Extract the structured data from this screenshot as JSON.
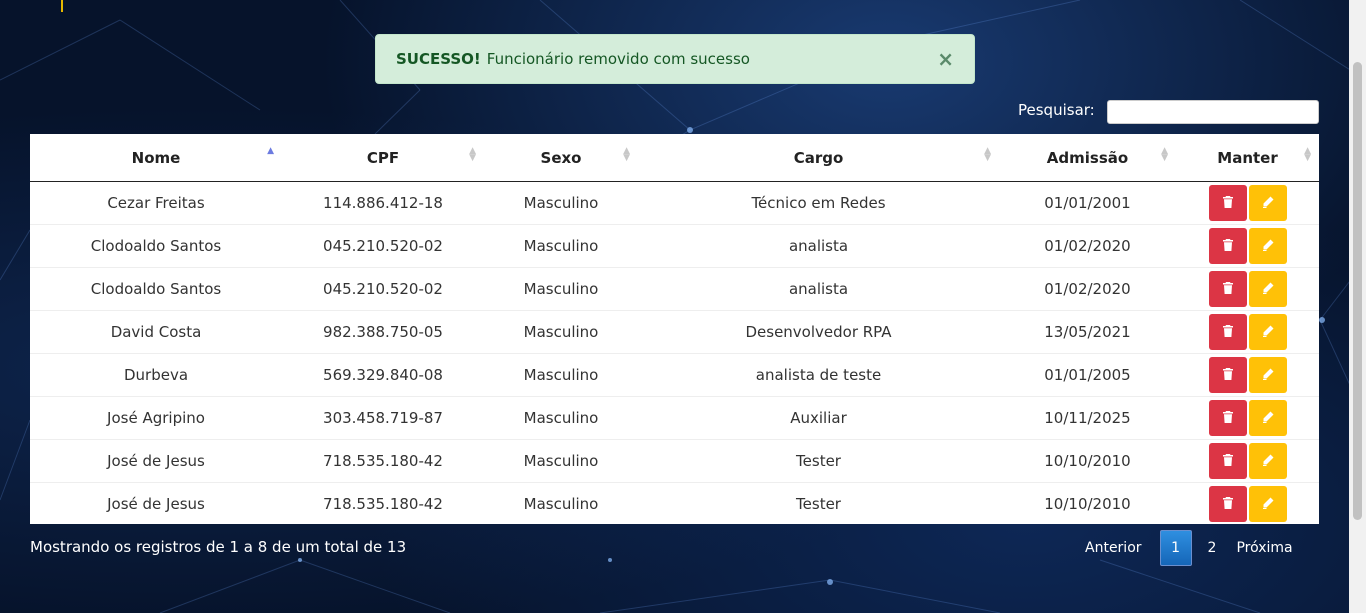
{
  "alert": {
    "title": "SUCESSO!",
    "message": "Funcionário removido com sucesso",
    "close": "×"
  },
  "search": {
    "label": "Pesquisar:",
    "value": "",
    "placeholder": ""
  },
  "table": {
    "columns": [
      "Nome",
      "CPF",
      "Sexo",
      "Cargo",
      "Admissão",
      "Manter"
    ],
    "sorted_column": "Nome",
    "rows": [
      {
        "nome": "Cezar Freitas",
        "cpf": "114.886.412-18",
        "sexo": "Masculino",
        "cargo": "Técnico em Redes",
        "admissao": "01/01/2001"
      },
      {
        "nome": "Clodoaldo Santos",
        "cpf": "045.210.520-02",
        "sexo": "Masculino",
        "cargo": "analista",
        "admissao": "01/02/2020"
      },
      {
        "nome": "Clodoaldo Santos",
        "cpf": "045.210.520-02",
        "sexo": "Masculino",
        "cargo": "analista",
        "admissao": "01/02/2020"
      },
      {
        "nome": "David Costa",
        "cpf": "982.388.750-05",
        "sexo": "Masculino",
        "cargo": "Desenvolvedor RPA",
        "admissao": "13/05/2021"
      },
      {
        "nome": "Durbeva",
        "cpf": "569.329.840-08",
        "sexo": "Masculino",
        "cargo": "analista de teste",
        "admissao": "01/01/2005"
      },
      {
        "nome": "José Agripino",
        "cpf": "303.458.719-87",
        "sexo": "Masculino",
        "cargo": "Auxiliar",
        "admissao": "10/11/2025"
      },
      {
        "nome": "José de Jesus",
        "cpf": "718.535.180-42",
        "sexo": "Masculino",
        "cargo": "Tester",
        "admissao": "10/10/2010"
      },
      {
        "nome": "José de Jesus",
        "cpf": "718.535.180-42",
        "sexo": "Masculino",
        "cargo": "Tester",
        "admissao": "10/10/2010"
      }
    ],
    "actions": {
      "delete_icon": "trash-icon",
      "edit_icon": "pencil-icon"
    }
  },
  "footer": {
    "info": "Mostrando os registros de 1 a 8 de um total de 13",
    "pagination": {
      "previous": "Anterior",
      "pages": [
        "1",
        "2"
      ],
      "current": "1",
      "next": "Próxima"
    }
  },
  "colors": {
    "success_bg": "#d4edda",
    "success_text": "#155724",
    "delete": "#dc3545",
    "edit": "#ffc107",
    "page_active": "#1e7ad0"
  }
}
